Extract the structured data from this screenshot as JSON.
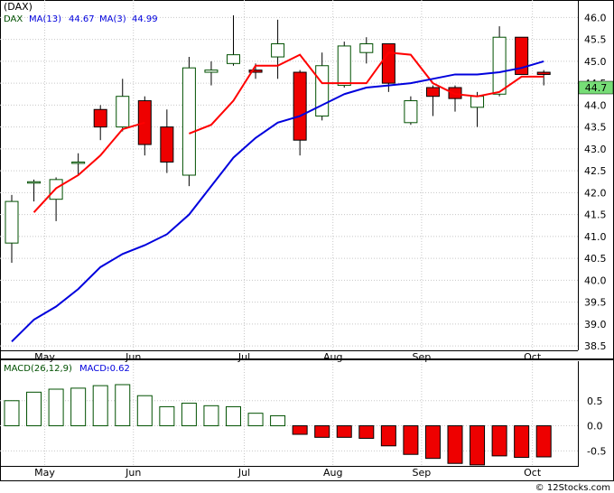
{
  "title": "(DAX)",
  "footer": "© 12Stocks.com",
  "colors": {
    "up_candle": "#ffffff",
    "down_candle": "#ee0000",
    "candle_outline_up": "#005000",
    "ma13": "#0000dd",
    "ma3": "#ff0000",
    "price_tag_bg": "#77dd77",
    "macd_up": "#ffffff",
    "macd_down": "#ee0000",
    "grid": "#c8c8c8"
  },
  "chart_data": [
    {
      "type": "candlestick",
      "legend": {
        "symbol": "DAX",
        "ma13_label": "MA(13)",
        "ma13_value": "44.67",
        "ma3_label": "MA(3)",
        "ma3_value": "44.99"
      },
      "last_price": "44.7",
      "ylim": [
        38.4,
        46.4
      ],
      "y_ticks": [
        "38.5",
        "39.0",
        "39.5",
        "40.0",
        "40.5",
        "41.0",
        "41.5",
        "42.0",
        "42.5",
        "43.0",
        "43.5",
        "44.0",
        "44.5",
        "45.0",
        "45.5",
        "46.0"
      ],
      "x_labels": [
        {
          "label": "May",
          "index": 1
        },
        {
          "label": "Jun",
          "index": 5
        },
        {
          "label": "Jul",
          "index": 10
        },
        {
          "label": "Aug",
          "index": 14
        },
        {
          "label": "Sep",
          "index": 18
        },
        {
          "label": "Oct",
          "index": 23
        }
      ],
      "candles": [
        {
          "open": 40.85,
          "high": 41.95,
          "low": 40.4,
          "close": 41.8
        },
        {
          "open": 42.25,
          "high": 42.3,
          "low": 41.8,
          "close": 42.25
        },
        {
          "open": 41.85,
          "high": 42.35,
          "low": 41.35,
          "close": 42.3
        },
        {
          "open": 42.7,
          "high": 42.9,
          "low": 42.4,
          "close": 42.7
        },
        {
          "open": 43.9,
          "high": 44.0,
          "low": 43.2,
          "close": 43.5
        },
        {
          "open": 43.5,
          "high": 44.6,
          "low": 43.4,
          "close": 44.2
        },
        {
          "open": 44.1,
          "high": 44.2,
          "low": 42.85,
          "close": 43.1
        },
        {
          "open": 43.5,
          "high": 43.9,
          "low": 42.45,
          "close": 42.7
        },
        {
          "open": 42.4,
          "high": 45.1,
          "low": 42.15,
          "close": 44.85
        },
        {
          "open": 44.75,
          "high": 45.0,
          "low": 44.45,
          "close": 44.8
        },
        {
          "open": 44.95,
          "high": 46.05,
          "low": 44.9,
          "close": 45.15
        },
        {
          "open": 44.8,
          "high": 44.95,
          "low": 44.6,
          "close": 44.75
        },
        {
          "open": 45.1,
          "high": 45.95,
          "low": 44.6,
          "close": 45.4
        },
        {
          "open": 44.75,
          "high": 44.8,
          "low": 42.85,
          "close": 43.2
        },
        {
          "open": 43.75,
          "high": 45.2,
          "low": 43.65,
          "close": 44.9
        },
        {
          "open": 44.45,
          "high": 45.45,
          "low": 44.4,
          "close": 45.35
        },
        {
          "open": 45.2,
          "high": 45.55,
          "low": 44.95,
          "close": 45.4
        },
        {
          "open": 45.4,
          "high": 45.35,
          "low": 44.3,
          "close": 44.5
        },
        {
          "open": 43.6,
          "high": 44.2,
          "low": 43.55,
          "close": 44.1
        },
        {
          "open": 44.4,
          "high": 44.45,
          "low": 43.75,
          "close": 44.2
        },
        {
          "open": 44.4,
          "high": 44.45,
          "low": 43.85,
          "close": 44.15
        },
        {
          "open": 43.95,
          "high": 44.3,
          "low": 43.5,
          "close": 44.2
        },
        {
          "open": 44.25,
          "high": 45.8,
          "low": 44.2,
          "close": 45.55
        },
        {
          "open": 45.55,
          "high": 45.55,
          "low": 44.7,
          "close": 44.7
        },
        {
          "open": 44.75,
          "high": 44.8,
          "low": 44.45,
          "close": 44.7
        }
      ],
      "ma13": [
        38.6,
        39.1,
        39.4,
        39.8,
        40.3,
        40.6,
        40.8,
        41.05,
        41.5,
        42.15,
        42.8,
        43.25,
        43.6,
        43.75,
        44.0,
        44.25,
        44.4,
        44.45,
        44.5,
        44.6,
        44.7,
        44.7,
        44.75,
        44.85,
        45.0
      ],
      "ma3": [
        null,
        41.55,
        42.1,
        42.4,
        42.85,
        43.45,
        43.6,
        null,
        43.35,
        43.55,
        44.1,
        44.9,
        44.9,
        45.15,
        44.5,
        44.5,
        44.5,
        45.2,
        45.15,
        44.5,
        44.25,
        44.2,
        44.3,
        44.65,
        44.65
      ]
    },
    {
      "type": "bar",
      "legend": {
        "label": "MACD(26,12,9)",
        "value_label": "MACD:",
        "value": "-0.62"
      },
      "ylim": [
        -0.8,
        1.0
      ],
      "y_ticks": [
        "0.5",
        "0.0",
        "-0.5"
      ],
      "x_labels": [
        {
          "label": "May",
          "index": 1
        },
        {
          "label": "Jun",
          "index": 5
        },
        {
          "label": "Jul",
          "index": 10
        },
        {
          "label": "Aug",
          "index": 14
        },
        {
          "label": "Sep",
          "index": 18
        },
        {
          "label": "Oct",
          "index": 23
        }
      ],
      "values": [
        0.5,
        0.67,
        0.73,
        0.75,
        0.8,
        0.82,
        0.6,
        0.38,
        0.45,
        0.4,
        0.38,
        0.25,
        0.2,
        -0.17,
        -0.23,
        -0.23,
        -0.25,
        -0.4,
        -0.57,
        -0.65,
        -0.75,
        -0.78,
        -0.6,
        -0.63,
        -0.62
      ]
    }
  ]
}
